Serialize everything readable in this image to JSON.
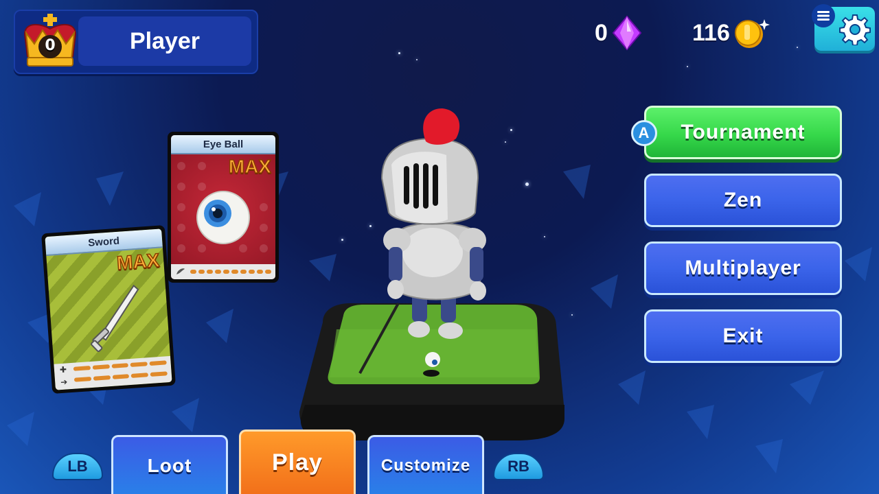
{
  "player": {
    "crown_count": "0",
    "name": "Player"
  },
  "currencies": {
    "gems": {
      "value": "0",
      "icon": "gem-icon",
      "color": "#c43cff"
    },
    "coins": {
      "value": "116",
      "icon": "coin-icon",
      "color": "#ffc20e"
    }
  },
  "settings": {
    "icon": "gear-icon"
  },
  "cards": [
    {
      "title": "Eye Ball",
      "badge": "MAX",
      "icon": "eyeball-icon",
      "theme": "#a82030"
    },
    {
      "title": "Sword",
      "badge": "MAX",
      "icon": "sword-icon",
      "theme": "#8aa02a"
    }
  ],
  "menu": {
    "a_badge": "A",
    "items": [
      {
        "label": "Tournament",
        "color": "#36d84a"
      },
      {
        "label": "Zen",
        "color": "#3b64ea"
      },
      {
        "label": "Multiplayer",
        "color": "#3b64ea"
      },
      {
        "label": "Exit",
        "color": "#3b64ea"
      }
    ]
  },
  "bottom_nav": {
    "left_shoulder": "LB",
    "right_shoulder": "RB",
    "tabs": [
      {
        "label": "Loot"
      },
      {
        "label": "Play",
        "active": true
      },
      {
        "label": "Customize"
      }
    ]
  }
}
